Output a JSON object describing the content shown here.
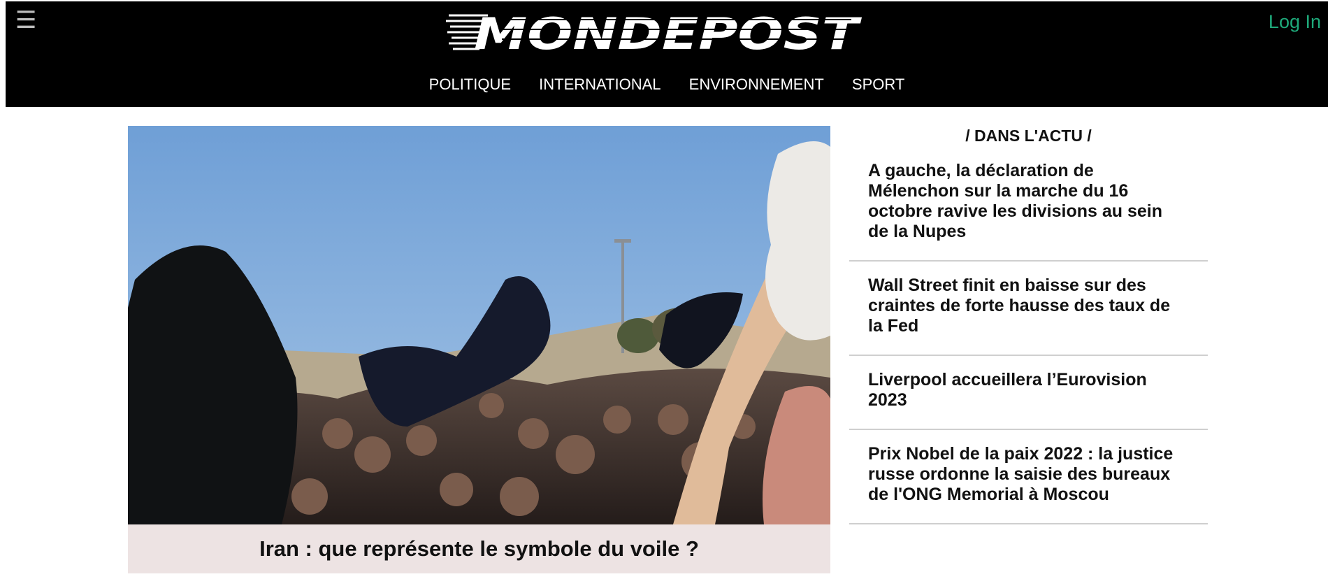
{
  "header": {
    "menu_icon": "☰",
    "logo_text": "MONDEPOST",
    "login_label": "Log In",
    "nav": [
      "POLITIQUE",
      "INTERNATIONAL",
      "ENVIRONNEMENT",
      "SPORT"
    ],
    "colors": {
      "background": "#000000",
      "login": "#1ea97a",
      "nav_text": "#ffffff"
    }
  },
  "hero": {
    "caption": "Iran : que représente le symbole du voile ?",
    "caption_bg": "#ede3e3"
  },
  "aside": {
    "title": "/ DANS L'ACTU /",
    "items": [
      "A gauche, la déclaration de Mélenchon sur la marche du 16 octobre ravive les divisions au sein de la Nupes",
      "Wall Street finit en baisse sur des craintes de forte hausse des taux de la Fed",
      "Liverpool accueillera l’Eurovision 2023",
      "Prix Nobel de la paix 2022 : la justice russe ordonne la saisie des bureaux de l'ONG Memorial à Moscou"
    ]
  }
}
